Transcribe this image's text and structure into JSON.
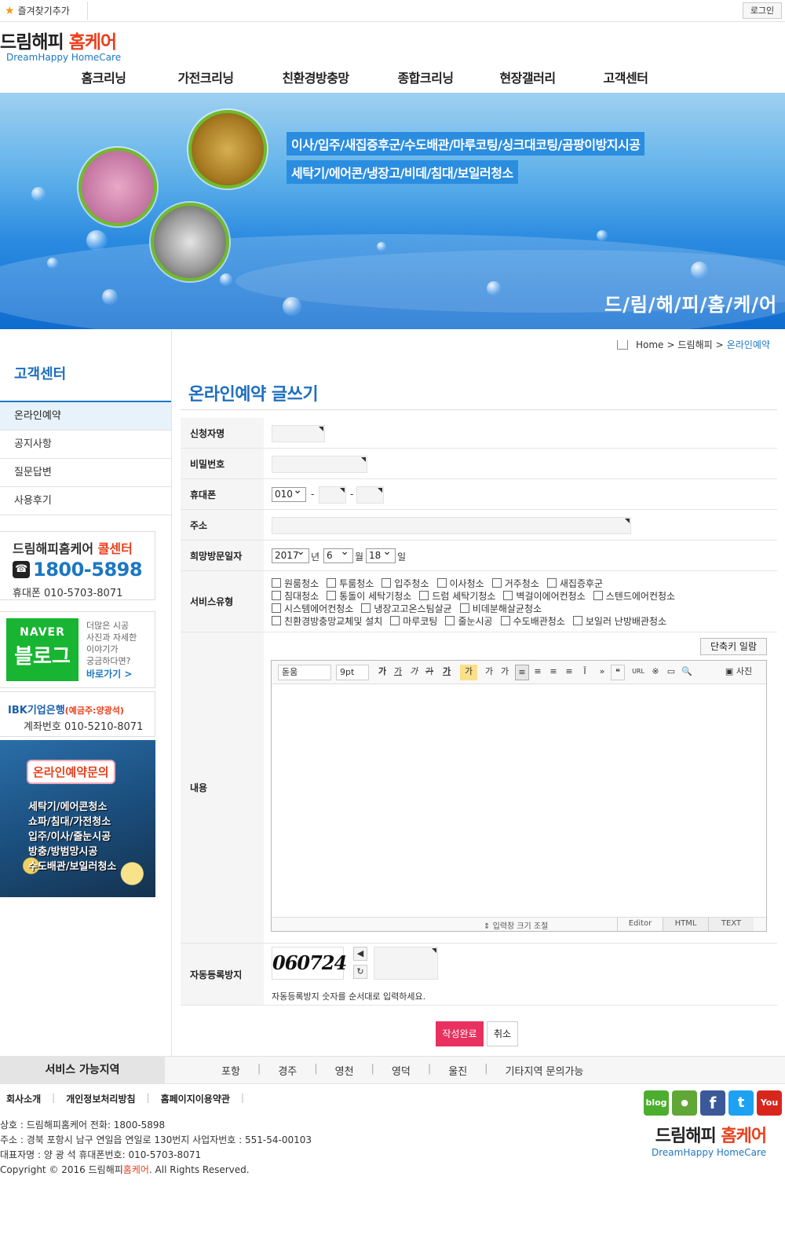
{
  "topbar": {
    "favorites_label": "즐겨찾기추가",
    "login_label": "로그인"
  },
  "logo": {
    "name_black": "드림해피",
    "name_red": "홈케어",
    "name_en": "DreamHappy HomeCare"
  },
  "nav": {
    "items": [
      "홈크리닝",
      "가전크리닝",
      "친환경방충망",
      "종합크리닝",
      "현장갤러리",
      "고객센터"
    ]
  },
  "banner": {
    "line1": "이사/입주/새집증후군/수도배관/마루코팅/싱크대코팅/곰팡이방지시공",
    "line2": "세탁기/에어콘/냉장고/비데/침대/보일러청소",
    "brand": "드/림/해/피/홈/케/어"
  },
  "sidebar": {
    "title": "고객센터",
    "items": [
      {
        "label": "온라인예약",
        "active": true
      },
      {
        "label": "공지사항",
        "active": false
      },
      {
        "label": "질문답변",
        "active": false
      },
      {
        "label": "사용후기",
        "active": false
      }
    ],
    "call": {
      "title_black": "드림해피홈케어",
      "title_red": "콜센터",
      "phone": "1800-5898",
      "mobile": "휴대폰 010-5703-8071"
    },
    "naver": {
      "top": "NAVER",
      "bottom": "블로그",
      "desc": [
        "더많은 시공",
        "사진과 자세한",
        "이야기가",
        "궁금하다면?"
      ],
      "go": "바로가기 >"
    },
    "bank": {
      "name": "IBK기업은행",
      "holder": "(예금주:양광석)",
      "account": "계좌번호 010-5210-8071"
    },
    "promo": {
      "title": "온라인예약문의",
      "lines": [
        "세탁기/에어콘청소",
        "쇼파/침대/가전청소",
        "입주/이사/줄눈시공",
        "방충/방범망시공",
        "수도배관/보일러청소"
      ]
    }
  },
  "breadcrumb": {
    "home": "Home",
    "sep1": ">",
    "parent": "드림해피",
    "sep2": ">",
    "current": "온라인예약"
  },
  "page_title": "온라인예약 글쓰기",
  "form": {
    "labels": {
      "name": "신청자명",
      "password": "비밀번호",
      "phone": "휴대폰",
      "address": "주소",
      "visit_date": "희망방문일자",
      "service": "서비스유형",
      "content": "내용",
      "captcha": "자동등록방지"
    },
    "phone": {
      "prefix": "010",
      "dash": "-"
    },
    "date": {
      "year": "2017",
      "year_unit": "년",
      "month": "6",
      "month_unit": "월",
      "day": "18",
      "day_unit": "일"
    },
    "services": [
      [
        "원룸청소",
        "투룸청소",
        "입주청소",
        "이사청소",
        "거주청소",
        "새집증후군"
      ],
      [
        "침대청소",
        "통돌이 세탁기청소",
        "드럼 세탁기청소",
        "벽걸이에어컨청소",
        "스텐드에어컨청소"
      ],
      [
        "시스템에어컨청소",
        "냉장고고온스팀살균",
        "비데분해살균청소"
      ],
      [
        "친환경방충망교체및 설치",
        "마루코팅",
        "줄눈시공",
        "수도배관청소",
        "보일러 난방배관청소"
      ]
    ],
    "editor": {
      "shortcut_label": "단축키 일람",
      "font": "돋움",
      "size": "9pt",
      "photo_label": "사진",
      "resize_label": "입력창 크기 조절",
      "modes": [
        "Editor",
        "HTML",
        "TEXT"
      ],
      "toolbar": [
        "가",
        "가",
        "가",
        "가",
        "가",
        "가",
        "가",
        "가",
        "»",
        "❝",
        "URL",
        "※",
        "▭",
        "🔍"
      ]
    },
    "captcha": {
      "image_text": "060724",
      "help": "자동등록방지 숫자를 순서대로 입력하세요."
    },
    "submit_label": "작성완료",
    "cancel_label": "취소"
  },
  "service_area": {
    "title": "서비스 가능지역",
    "regions": [
      "포항",
      "경주",
      "영천",
      "영덕",
      "울진",
      "기타지역 문의가능"
    ],
    "sep": "|"
  },
  "footer": {
    "links": [
      "회사소개",
      "개인정보처리방침",
      "홈페이지이용약관"
    ],
    "sep": "|",
    "info": [
      "상호 : 드림해피홈케어   전화: 1800-5898",
      "주소 : 경북 포항시 남구 연일읍 연일로 130번지   사업자번호 : 551-54-00103",
      "대표자명 : 양 광 석    휴대폰번호: 010-5703-8071"
    ],
    "copyright_pre": "Copyright © 2016 드림해피",
    "copyright_red": "홈케어",
    "copyright_post": ". All Rights Reserved.",
    "sns": [
      {
        "name": "blog",
        "color": "#4cae2f",
        "label": "blog"
      },
      {
        "name": "story",
        "color": "#5fa736",
        "label": "●"
      },
      {
        "name": "facebook",
        "color": "#3b5998",
        "label": "f"
      },
      {
        "name": "twitter",
        "color": "#1da1f2",
        "label": "t"
      },
      {
        "name": "youtube",
        "color": "#d9261c",
        "label": "You"
      }
    ],
    "logo_black": "드림해피",
    "logo_red": "홈케어",
    "logo_en": "DreamHappy HomeCare"
  }
}
